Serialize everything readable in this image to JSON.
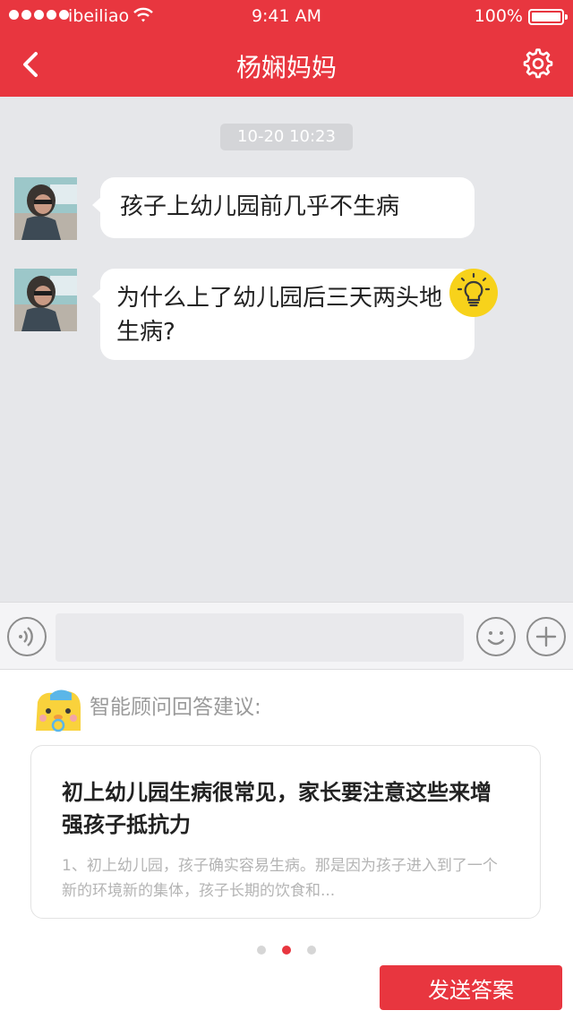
{
  "status_bar": {
    "carrier": "ibeiliao",
    "time": "9:41 AM",
    "battery": "100%"
  },
  "nav": {
    "title": "杨娴妈妈",
    "back_icon": "chevron-left-icon",
    "settings_icon": "gear-icon"
  },
  "chat": {
    "timestamp": "10-20 10:23",
    "messages": [
      {
        "text": "孩子上幼儿园前几乎不生病"
      },
      {
        "text": "为什么上了幼儿园后三天两头地生病?"
      }
    ]
  },
  "input_bar": {
    "placeholder": "",
    "icons": [
      "voice-icon",
      "emoji-icon",
      "plus-icon"
    ]
  },
  "suggestions": {
    "label": "智能顾问回答建议:",
    "card": {
      "title": "初上幼儿园生病很常见，家长要注意这些来增强孩子抵抗力",
      "body": "1、初上幼儿园，孩子确实容易生病。那是因为孩子进入到了一个新的环境新的集体，孩子长期的饮食和..."
    },
    "page_count": 3,
    "current_page": 2,
    "send_label": "发送答案"
  },
  "colors": {
    "brand": "#e8363f",
    "chat_bg": "#e6e7ea",
    "bulb": "#f7d21b"
  }
}
